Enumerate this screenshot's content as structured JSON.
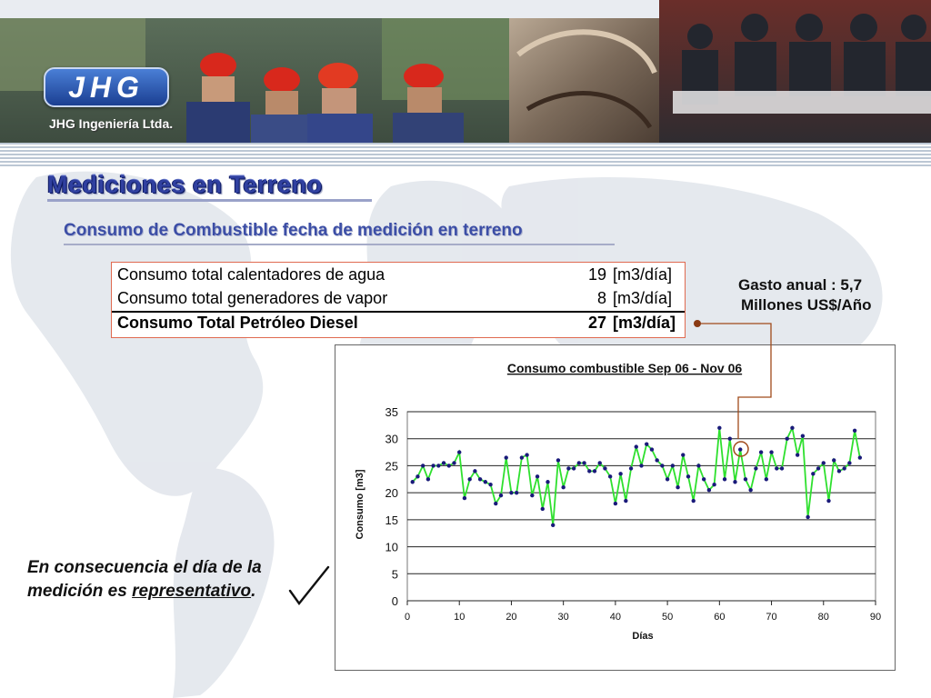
{
  "header": {
    "logo_text": "JHG",
    "company": "JHG Ingeniería Ltda."
  },
  "title": "Mediciones en Terreno",
  "subtitle": "Consumo de Combustible fecha de medición en terreno",
  "consumption_table": {
    "rows": [
      {
        "label": "Consumo total calentadores de agua",
        "value": "19",
        "unit": "[m3/día]"
      },
      {
        "label": "Consumo total generadores de vapor",
        "value": "8",
        "unit": "[m3/día]"
      }
    ],
    "total": {
      "label": "Consumo Total Petróleo Diesel",
      "value": "27",
      "unit": "[m3/día]"
    }
  },
  "annual_cost": {
    "line1": "Gasto anual : 5,7",
    "line2": "Millones US$/Año"
  },
  "conclusion": {
    "text_part1": "En consecuencia el día de la medición es ",
    "text_underlined": "representativo",
    "text_part2": "."
  },
  "colors": {
    "title": "#3040a0",
    "table_border": "#e06a50",
    "line_series": "#2ee02e",
    "markers": "#1a1a7a",
    "connector": "#a04a1a"
  },
  "chart_data": {
    "type": "line",
    "title": "Consumo combustible Sep 06 - Nov 06",
    "xlabel": "Días",
    "ylabel": "Consumo [m3]",
    "xlim": [
      0,
      90
    ],
    "ylim": [
      0,
      35
    ],
    "xticks": [
      0,
      10,
      20,
      30,
      40,
      50,
      60,
      70,
      80,
      90
    ],
    "yticks": [
      0,
      5,
      10,
      15,
      20,
      25,
      30,
      35
    ],
    "grid": "horizontal",
    "highlighted_point": {
      "x": 68,
      "y": 27.5
    },
    "series": [
      {
        "x": [
          1,
          2,
          3,
          4,
          5,
          6,
          7,
          8,
          9,
          10,
          11,
          12,
          13,
          14,
          15,
          16,
          17,
          18,
          19,
          20,
          21,
          22,
          23,
          24,
          25,
          26,
          27,
          28,
          29,
          30,
          31,
          32,
          33,
          34,
          35,
          36,
          37,
          38,
          39,
          40,
          41,
          42,
          43,
          44,
          45,
          46,
          47,
          48,
          49,
          50,
          51,
          52,
          53,
          54,
          55,
          56,
          57,
          58,
          59,
          60,
          61,
          62,
          63,
          64,
          65,
          66,
          67,
          68,
          69,
          70,
          71,
          72,
          73,
          74,
          75,
          76,
          77,
          78,
          79,
          80,
          81,
          82,
          83,
          84,
          85,
          86,
          87
        ],
        "y": [
          22,
          23,
          25,
          22.5,
          25,
          25,
          25.5,
          25,
          25.5,
          27.5,
          19,
          22.5,
          24,
          22.5,
          22,
          21.5,
          18,
          19.5,
          26.5,
          20,
          20,
          26.5,
          27,
          19.5,
          23,
          17,
          22,
          14,
          26,
          21,
          24.5,
          24.5,
          25.5,
          25.5,
          24,
          24,
          25.5,
          24.5,
          23,
          18,
          23.5,
          18.5,
          24.5,
          28.5,
          25,
          29,
          28,
          26,
          25,
          22.5,
          25,
          21,
          27,
          23,
          18.5,
          25,
          22.5,
          20.5,
          21.5,
          32,
          22.5,
          30,
          22,
          28,
          22.5,
          20.5,
          24.5,
          27.5,
          22.5,
          27.5,
          24.5,
          24.5,
          30,
          32,
          27,
          30.5,
          15.5,
          23.5,
          24.5,
          25.5,
          18.5,
          26,
          24,
          24.5,
          25.5,
          31.5,
          26.5
        ]
      }
    ]
  }
}
